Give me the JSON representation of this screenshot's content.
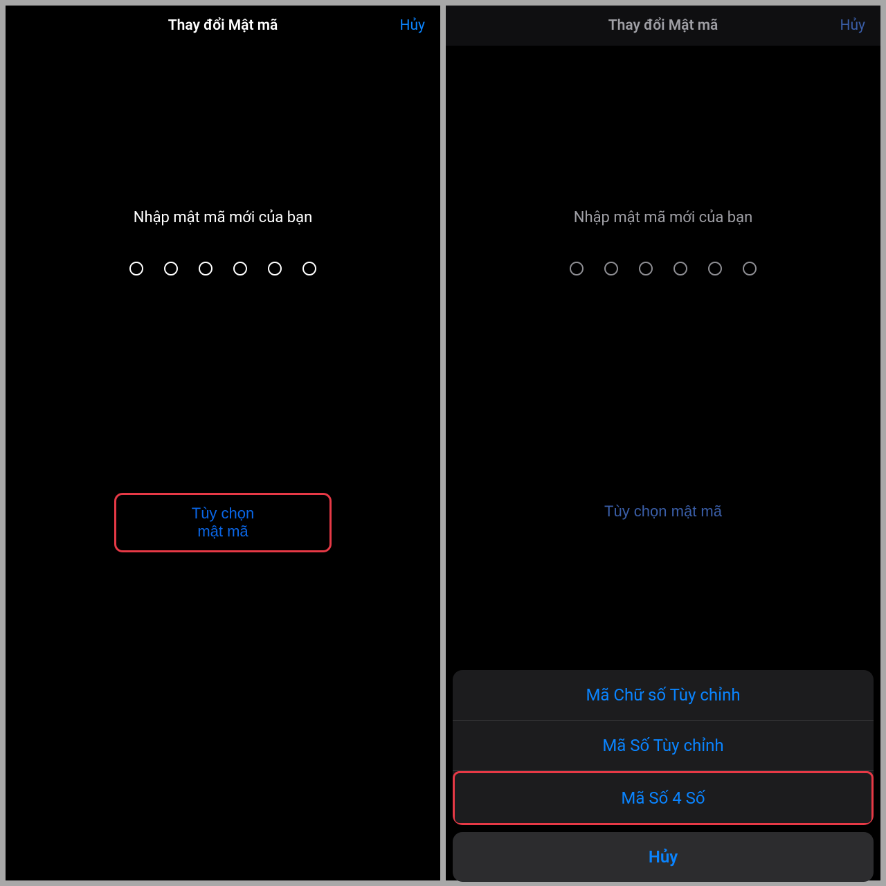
{
  "left": {
    "nav": {
      "title": "Thay đổi Mật mã",
      "cancel": "Hủy"
    },
    "prompt": "Nhập mật mã mới của bạn",
    "options_button": "Tùy chọn mật mã"
  },
  "right": {
    "nav": {
      "title": "Thay đổi Mật mã",
      "cancel": "Hủy"
    },
    "prompt": "Nhập mật mã mới của bạn",
    "options_button": "Tùy chọn mật mã",
    "action_sheet": {
      "options": [
        "Mã Chữ số Tùy chỉnh",
        "Mã Số Tùy chỉnh",
        "Mã Số 4 Số"
      ],
      "cancel": "Hủy"
    }
  },
  "colors": {
    "accent": "#0a84ff",
    "highlight": "#e63946"
  }
}
